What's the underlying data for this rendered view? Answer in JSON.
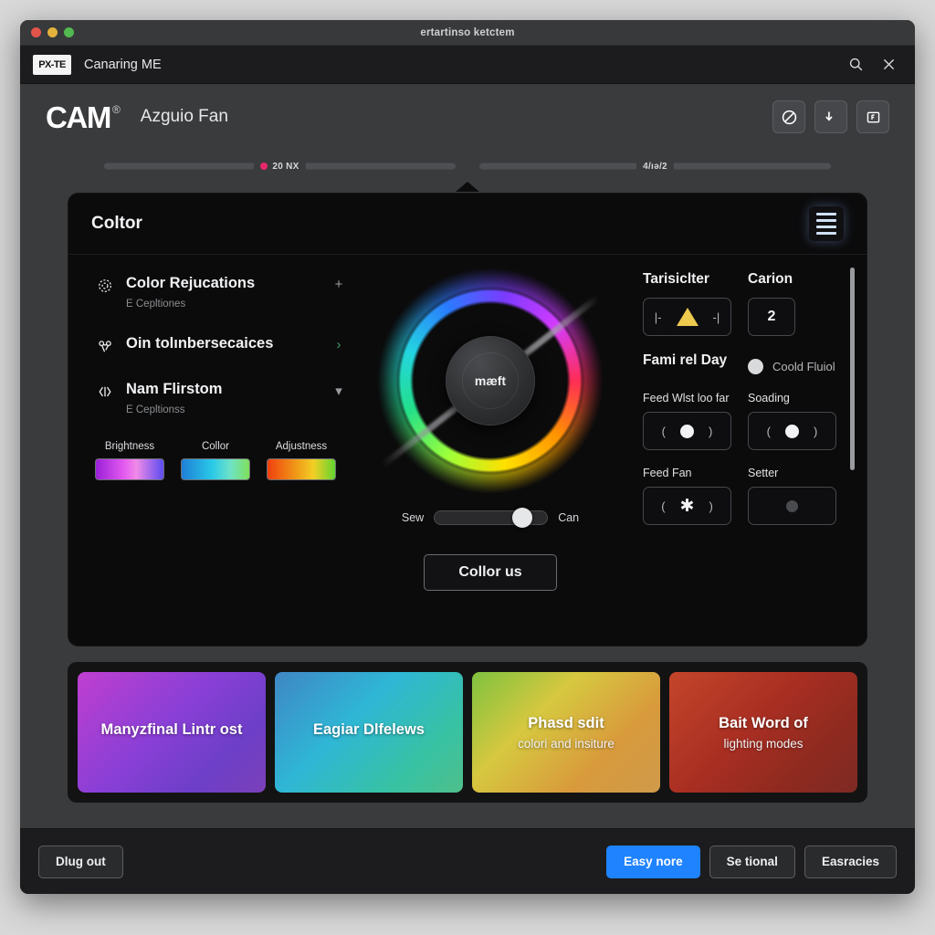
{
  "window": {
    "title": "ertartinso ketctem",
    "traffic_lights": [
      "close",
      "minimize",
      "zoom"
    ]
  },
  "tabstrip": {
    "badge": "PX-TE",
    "tab_label": "Canaring ME",
    "search_icon": "search-icon",
    "close_icon": "close-icon"
  },
  "header": {
    "brand": "CAM",
    "registered": "®",
    "subtitle": "Azguio Fan",
    "buttons": [
      {
        "name": "block-icon",
        "glyph": "block"
      },
      {
        "name": "download-arrow-icon",
        "glyph": "arrow-down"
      },
      {
        "name": "screen-icon",
        "glyph": "screen-f"
      }
    ]
  },
  "steps": [
    {
      "label": "20 NX",
      "dot_color": "#e8276a",
      "has_dot": true
    },
    {
      "label": "4/ıə/2",
      "has_dot": false
    }
  ],
  "panel": {
    "title": "Coltor",
    "menu_icon": "hamburger-menu-icon",
    "options": [
      {
        "icon": "gear-dotted-icon",
        "title": "Color Rejucations",
        "subtitle": "E Cepltiones",
        "action": "+",
        "action_kind": "plus"
      },
      {
        "icon": "nodes-icon",
        "title": "Oin tolınbersecaices",
        "subtitle": "",
        "action": "›",
        "action_kind": "chevron-right"
      },
      {
        "icon": "code-brackets-icon",
        "title": "Nam Flirstom",
        "subtitle": "E Cepltionss",
        "action": "▾",
        "action_kind": "chevron-down"
      }
    ],
    "swatches": [
      {
        "label": "Brightness",
        "gradient": "linear-gradient(90deg,#9a20d8 0%,#e45bf0 42%,#f08ae8 60%,#5b4df0 100%)"
      },
      {
        "label": "Collor",
        "gradient": "linear-gradient(90deg,#1f7fd6 0%,#29c9e8 45%,#6ee2c8 72%,#7fe05a 100%)"
      },
      {
        "label": "Adjustness",
        "gradient": "linear-gradient(90deg,#f0400f 0%,#f08a16 35%,#f2cf24 68%,#63d430 100%)"
      }
    ],
    "wheel": {
      "hub_text": "mæft",
      "slider_left": "Sew",
      "slider_right": "Can",
      "slider_value": 78
    },
    "action_button": "Collor us",
    "right": {
      "groups": [
        {
          "head": "Tarisiclter",
          "control": "triangle",
          "value": ""
        },
        {
          "head": "Carion",
          "control": "value",
          "value": "2"
        }
      ],
      "section_title": "Fami rel Day",
      "radio_label": "Coold Fluiol",
      "fields": [
        {
          "label": "Feed Wlst loo far",
          "control": "dot-white"
        },
        {
          "label": "Soading",
          "control": "dot-white"
        },
        {
          "label": "Feed Fan",
          "control": "star"
        },
        {
          "label": "Setter",
          "control": "dot-dim"
        }
      ]
    }
  },
  "presets": [
    {
      "title": "Manyzfinal Lintr ost",
      "subtitle": "",
      "gradient": "linear-gradient(135deg,#c03fd0 0%,#8a3fd6 45%,#6d3fc8 75%,#7a40b8 100%)"
    },
    {
      "title": "Eagiar Dlfelews",
      "subtitle": "",
      "gradient": "linear-gradient(135deg,#3f86c4 0%,#2fb6d6 40%,#37c2a4 75%,#4fbf8a 100%)"
    },
    {
      "title": "Phasd sdit",
      "subtitle": "colori and insiture",
      "gradient": "linear-gradient(135deg,#7fc23f 0%,#d6c83f 35%,#d89a3c 70%,#cf9a4a 100%)"
    },
    {
      "title": "Bait Word of",
      "subtitle": "lighting modes",
      "gradient": "linear-gradient(135deg,#c4452a 0%,#a82e22 45%,#8e2a20 75%,#7d2a24 100%)"
    }
  ],
  "footer": {
    "left_button": "Dlug out",
    "right_buttons": [
      {
        "label": "Easy nore",
        "primary": true
      },
      {
        "label": "Se tional",
        "primary": false
      },
      {
        "label": "Easracies",
        "primary": false
      }
    ]
  },
  "colors": {
    "accent_blue": "#1f82ff",
    "accent_pink": "#e8276a",
    "panel_bg": "#0b0b0c",
    "window_bg": "#3a3b3d"
  }
}
